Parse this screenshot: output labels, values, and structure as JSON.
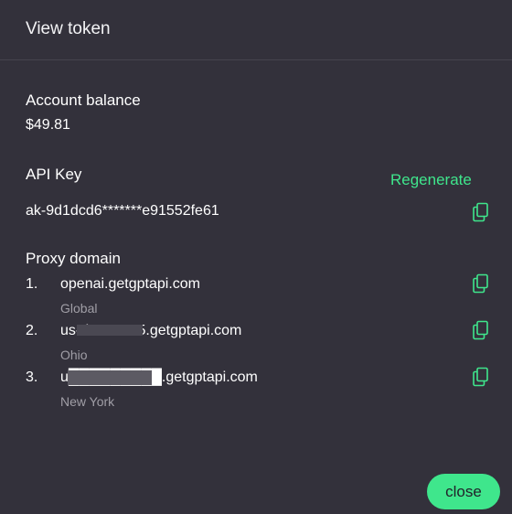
{
  "dialog": {
    "title": "View token"
  },
  "balance": {
    "label": "Account balance",
    "value": "$49.81"
  },
  "api_key": {
    "label": "API Key",
    "regenerate_label": "Regenerate",
    "value": "ak-9d1dcd6*******e91552fe61",
    "copy_icon": "copy-icon"
  },
  "proxy": {
    "label": "Proxy domain",
    "items": [
      {
        "number": "1.",
        "domain": "openai.getgptapi.com",
        "region": "Global"
      },
      {
        "number": "2.",
        "domain": "us-d3e99075.getgptapi.com",
        "region": "Ohio"
      },
      {
        "number": "3.",
        "domain": "u█████████.getgptapi.com",
        "region": "New York"
      }
    ]
  },
  "footer": {
    "close_label": "close"
  },
  "colors": {
    "background": "#33313b",
    "accent": "#3fe68c",
    "muted_text": "#a09ea6"
  }
}
